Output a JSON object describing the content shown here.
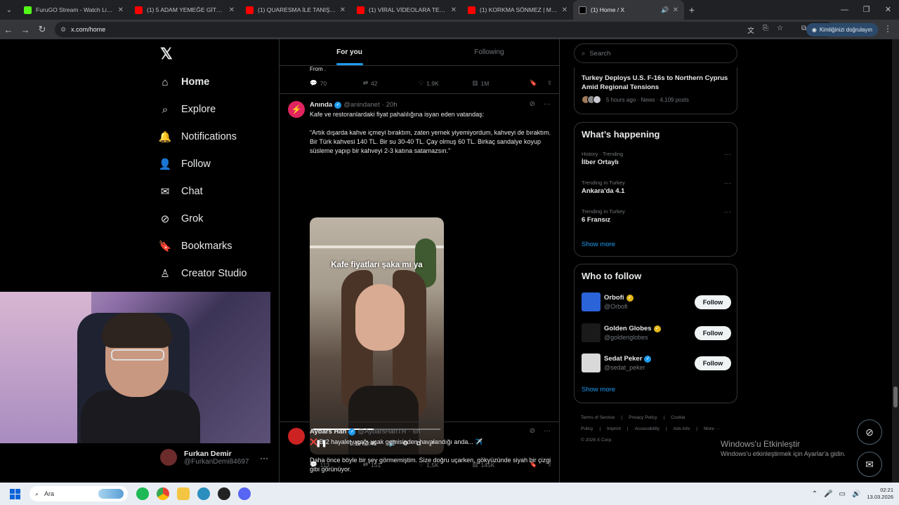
{
  "browser": {
    "tabs": [
      {
        "title": "FuruGO Stream - Watch Live on",
        "color": "#53fc18",
        "active": false
      },
      {
        "title": "(1) 5 ADAM YEMEĞE GİTTİK, TA",
        "color": "#ff0000",
        "active": false
      },
      {
        "title": "(1) QUARESMA İLE TANIŞTIM |",
        "color": "#ff0000",
        "active": false
      },
      {
        "title": "(1) VİRAL VİDEOLARA TEPKİ - Y",
        "color": "#ff0000",
        "active": false
      },
      {
        "title": "(1) KORKMA SÖNMEZ | Madara",
        "color": "#ff0000",
        "active": false
      },
      {
        "title": "(1) Home / X",
        "color": "#000000",
        "active": true
      }
    ],
    "url": "x.com/home",
    "verify_label": "Kimliğinizi doğrulayın"
  },
  "nav": {
    "items": [
      {
        "label": "Home",
        "icon": "home-icon",
        "glyph": "⌂"
      },
      {
        "label": "Explore",
        "icon": "search-icon",
        "glyph": "⌕"
      },
      {
        "label": "Notifications",
        "icon": "bell-icon",
        "glyph": "🔔",
        "badge": "1"
      },
      {
        "label": "Follow",
        "icon": "add-person-icon",
        "glyph": "👤"
      },
      {
        "label": "Chat",
        "icon": "mail-icon",
        "glyph": "✉"
      },
      {
        "label": "Grok",
        "icon": "grok-icon",
        "glyph": "⊘"
      },
      {
        "label": "Bookmarks",
        "icon": "bookmark-icon",
        "glyph": "🔖"
      },
      {
        "label": "Creator Studio",
        "icon": "creator-icon",
        "glyph": "♙"
      }
    ],
    "account": {
      "name": "Furkan Demir",
      "handle": "@FurkanDemi84697"
    }
  },
  "timeline": {
    "tabs": [
      "For you",
      "Following"
    ],
    "prev_tail": "From .",
    "prev_stats": {
      "replies": "70",
      "reposts": "42",
      "likes": "1.9K",
      "views": "1M"
    },
    "tweet1": {
      "name": "Anında",
      "handle": "@anindanet",
      "time": "20h",
      "text": "Kafe ve restoranlardaki fiyat pahalılığına isyan eden vatandaş:\n\n“Artık dışarda kahve içmeyi bıraktım, zaten yemek yiyemiyordum, kahveyi de bıraktım. Bir Türk kahvesi 140 TL. Bir su 30-40 TL. Çay olmuş 60 TL. Birkaç sandalye koyup süsleme yapıp bir kahveyi 2-3 katına satamazsın.”",
      "video": {
        "caption": "Kafe fiyatları şaka mı ya",
        "time": "0:19 / 0:40",
        "progress": 0.475
      },
      "stats": {
        "replies": "113",
        "reposts": "151",
        "likes": "1,5K",
        "views": "145K"
      }
    },
    "tweet2": {
      "name": "Aybars Han",
      "handle": "@AybarsHanTR",
      "time": "6h",
      "text": "❌ B-2 hayalet uçağı uçak gemisinden havalandığı anda... ✈️\n\nDaha önce böyle bir şey görmemiştim. Size doğru uçarken, gökyüzünde siyah bir çizgi gibi görünüyor."
    }
  },
  "sidebar": {
    "search_placeholder": "Search",
    "news": {
      "title": "Turkey Deploys U.S. F-16s to Northern Cyprus Amid Regional Tensions",
      "meta": "5 hours ago · News · 4,109 posts"
    },
    "happening": {
      "title": "What’s happening",
      "trends": [
        {
          "context": "History · Trending",
          "name": "İlber Ortaylı"
        },
        {
          "context": "Trending in Turkey",
          "name": "Ankara'da 4.1"
        },
        {
          "context": "Trending in Turkey",
          "name": "6 Fransız"
        }
      ],
      "show_more": "Show more"
    },
    "who_to_follow": {
      "title": "Who to follow",
      "accounts": [
        {
          "name": "Orbofi",
          "handle": "@Orbofi",
          "badge": "gold",
          "button": "Follow",
          "color": "#2b63d9"
        },
        {
          "name": "Golden Globes",
          "handle": "@goldenglobes",
          "badge": "gold",
          "button": "Follow",
          "color": "#1a1a1a"
        },
        {
          "name": "Sedat Peker",
          "handle": "@sedat_peker",
          "badge": "blue",
          "button": "Follow",
          "color": "#d9d9d9"
        }
      ],
      "show_more": "Show more"
    },
    "footer": {
      "links": [
        "Terms of Service",
        "|",
        "Privacy Policy",
        "|",
        "Cookie Policy",
        "|",
        "Imprint",
        "|",
        "Accessibility",
        "|",
        "Ads info",
        "|",
        "More ···"
      ],
      "copyright": "© 2026 X Corp."
    }
  },
  "windows": {
    "activate_title": "Windows'u Etkinleştir",
    "activate_sub": "Windows'u etkinleştirmek için Ayarlar'a gidin.",
    "search_label": "Ara",
    "time": "02:21",
    "date": "13.03.2026"
  }
}
